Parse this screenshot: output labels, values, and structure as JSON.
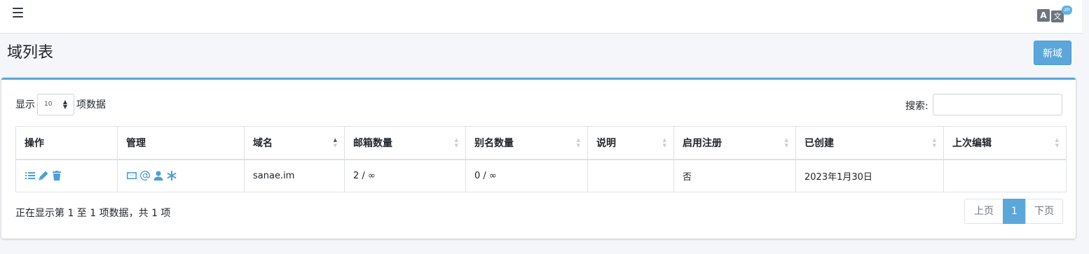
{
  "header": {
    "lang_icon_a": "A",
    "lang_icon_b": "文",
    "lang_badge": "zh"
  },
  "page": {
    "title": "域列表",
    "new_button": "新域"
  },
  "table_controls": {
    "show_label": "显示",
    "page_length": "10",
    "records_label": "项数据",
    "search_label": "搜索:",
    "search_value": ""
  },
  "table": {
    "columns": [
      "操作",
      "管理",
      "域名",
      "邮箱数量",
      "别名数量",
      "说明",
      "启用注册",
      "已创建",
      "上次编辑"
    ],
    "rows": [
      {
        "domain": "sanae.im",
        "mailboxes": "2 / ∞",
        "aliases": "0 / ∞",
        "description": "",
        "registration": "否",
        "created": "2023年1月30日",
        "modified": ""
      }
    ]
  },
  "footer": {
    "info": "正在显示第 1 至 1 项数据，共 1 项",
    "prev": "上页",
    "current_page": "1",
    "next": "下页"
  },
  "icons": {
    "actions": [
      "list-icon",
      "pencil-icon",
      "trash-icon"
    ],
    "manage": [
      "envelope-icon",
      "at-icon",
      "user-icon",
      "asterisk-icon"
    ]
  },
  "colors": {
    "accent": "#5ba7da",
    "icon": "#4a9fd8"
  }
}
